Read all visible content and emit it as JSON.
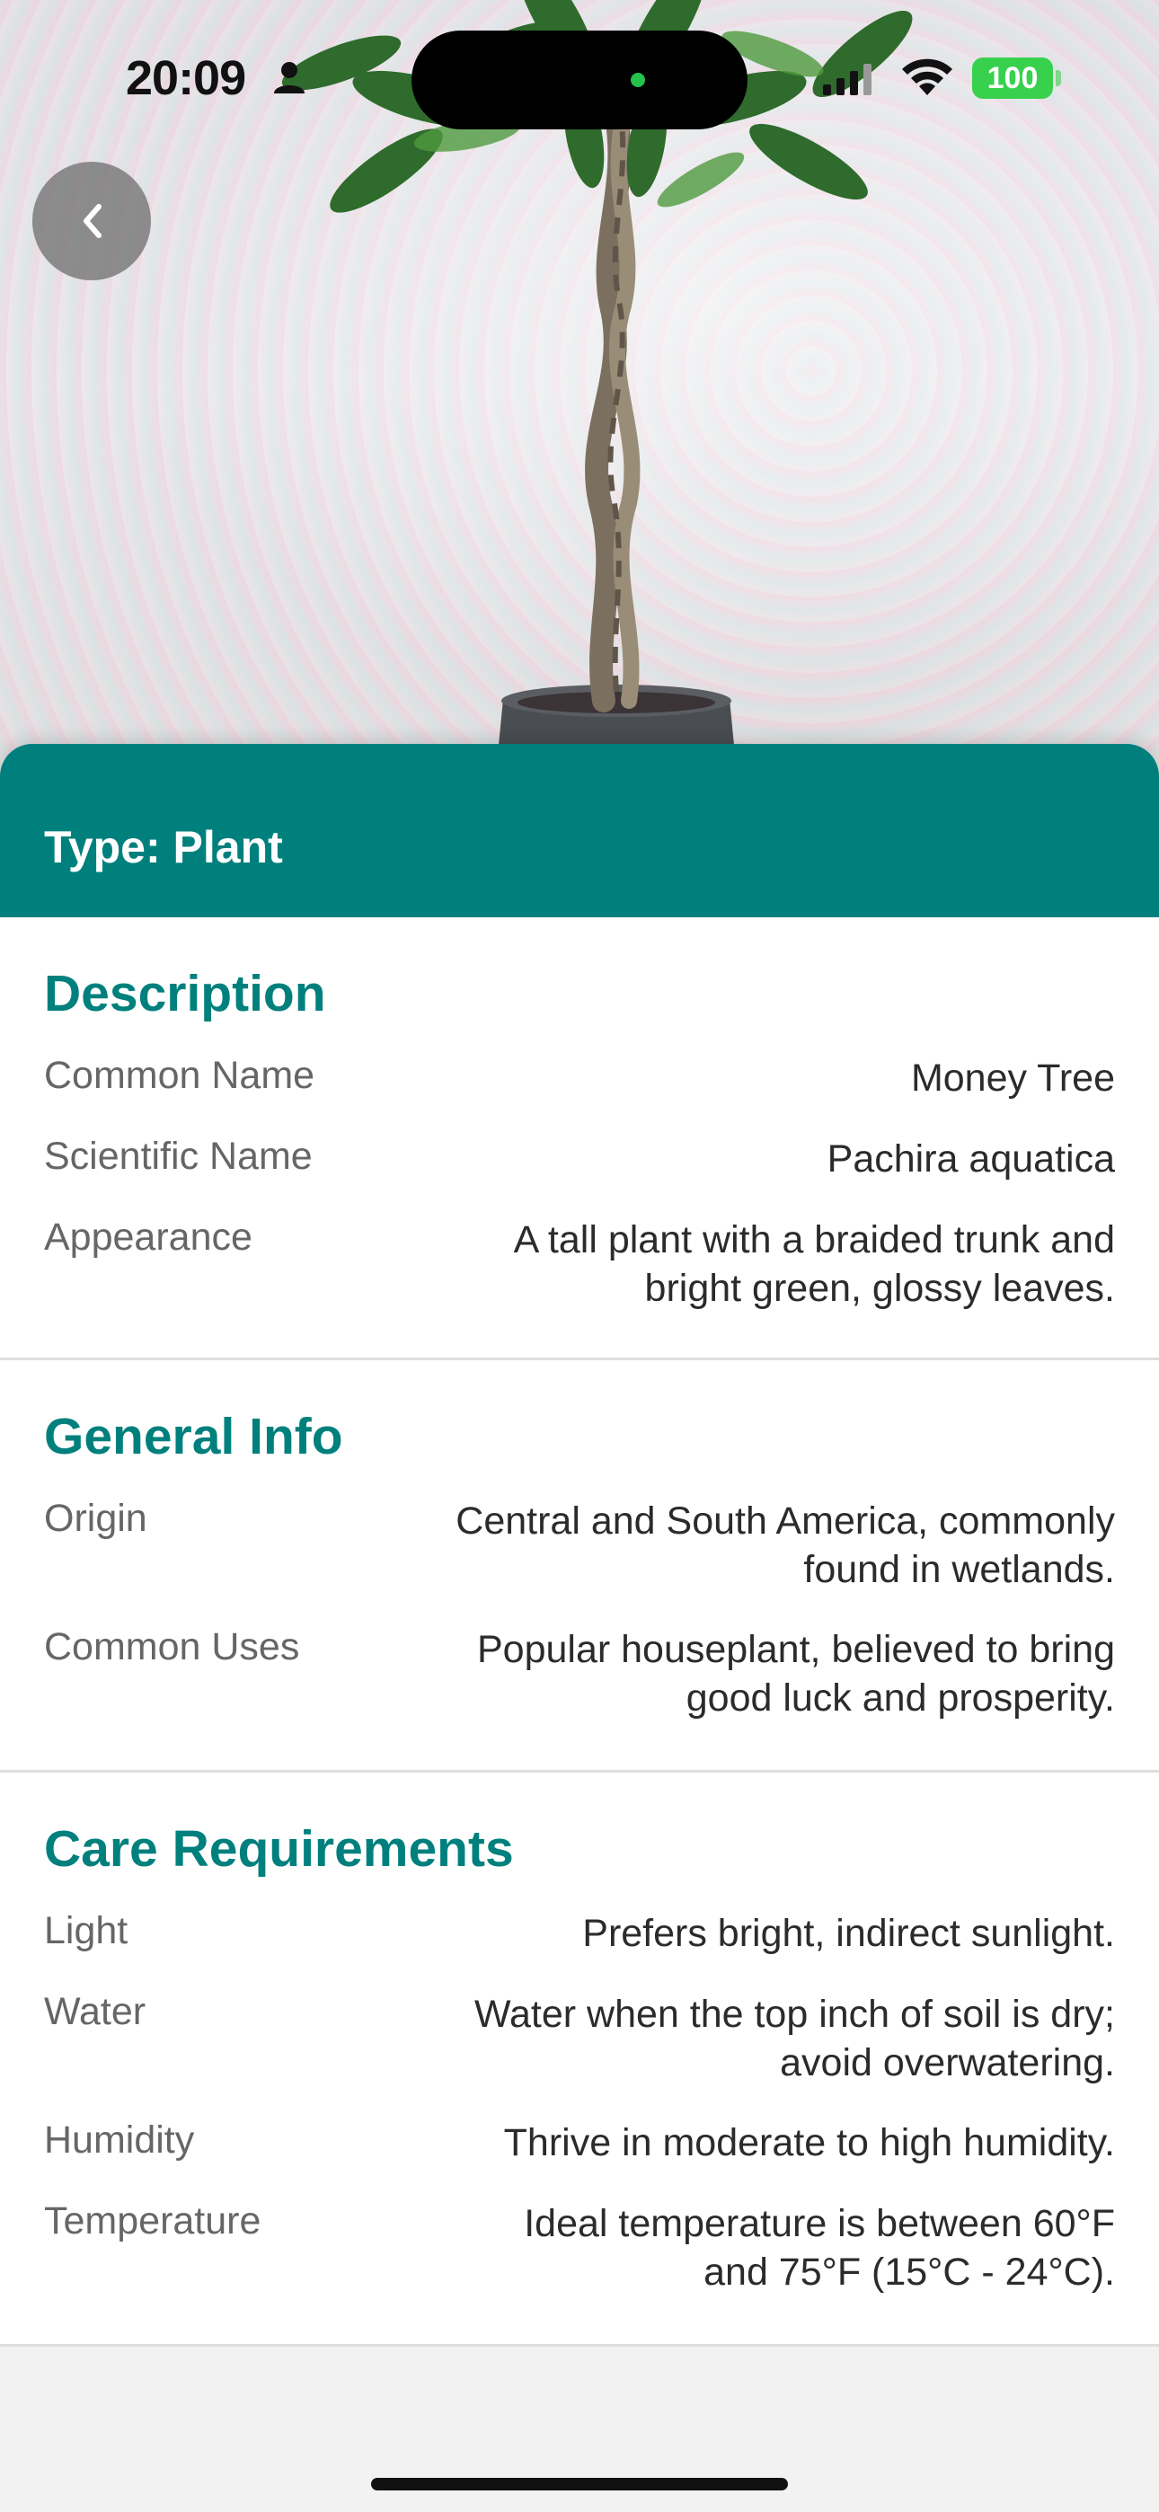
{
  "status_bar": {
    "time": "20:09",
    "battery": "100",
    "icons": [
      "person-icon",
      "cellular-signal-icon",
      "wifi-icon",
      "battery-icon"
    ]
  },
  "navigation": {
    "back_icon": "chevron-left-icon"
  },
  "type_label": "Type: Plant",
  "sections": [
    {
      "title": "Description",
      "rows": [
        {
          "label": "Common Name",
          "value": "Money Tree"
        },
        {
          "label": "Scientific Name",
          "value": "Pachira aquatica"
        },
        {
          "label": "Appearance",
          "value": "A tall plant with a braided trunk and bright green, glossy leaves."
        }
      ]
    },
    {
      "title": "General Info",
      "rows": [
        {
          "label": "Origin",
          "value": "Central and South America, commonly found in wetlands."
        },
        {
          "label": "Common Uses",
          "value": "Popular houseplant, believed to bring good luck and prosperity."
        }
      ]
    },
    {
      "title": "Care Requirements",
      "rows": [
        {
          "label": "Light",
          "value": "Prefers bright, indirect sunlight."
        },
        {
          "label": "Water",
          "value": "Water when the top inch of soil is dry; avoid overwatering."
        },
        {
          "label": "Humidity",
          "value": "Thrive in moderate to high humidity."
        },
        {
          "label": "Temperature",
          "value": "Ideal temperature is between 60°F and 75°F (15°C - 24°C)."
        }
      ]
    }
  ],
  "colors": {
    "accent": "#00807d",
    "battery": "#38d14e",
    "background": "#f2f2f2"
  }
}
